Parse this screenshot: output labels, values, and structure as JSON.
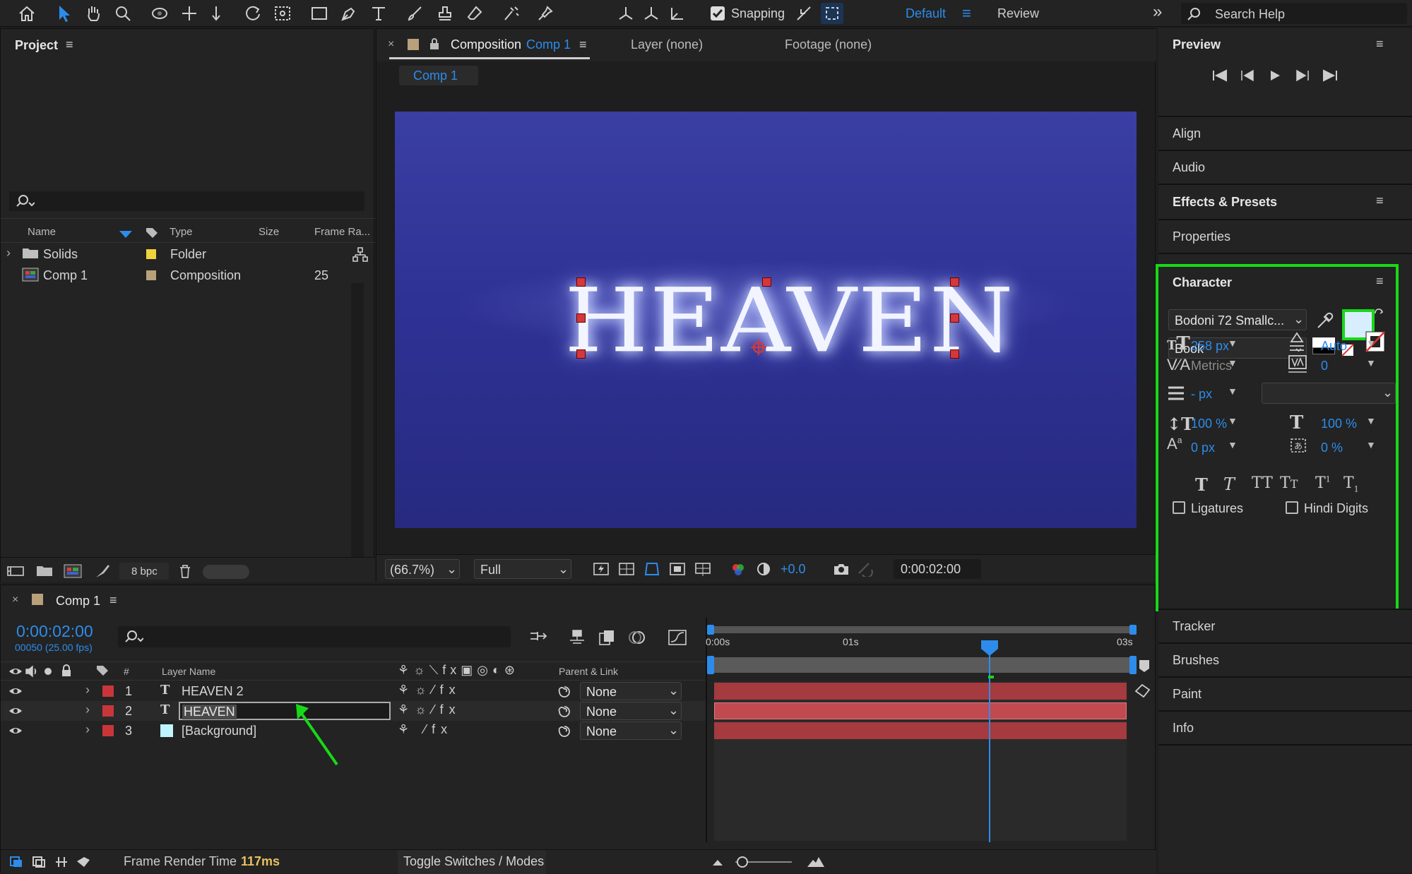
{
  "toolbar": {
    "snapping_label": "Snapping",
    "workspace_default": "Default",
    "workspace_review": "Review",
    "search_placeholder": "Search Help"
  },
  "project": {
    "title": "Project",
    "columns": {
      "name": "Name",
      "type": "Type",
      "size": "Size",
      "frame_rate": "Frame Ra..."
    },
    "items": [
      {
        "name": "Solids",
        "type": "Folder",
        "frame_rate": "",
        "color": "#f0d23c"
      },
      {
        "name": "Comp 1",
        "type": "Composition",
        "frame_rate": "25",
        "color": "#b8a07a"
      }
    ],
    "bit_depth": "8 bpc"
  },
  "composition": {
    "tab_prefix": "Composition",
    "tab_name": "Comp 1",
    "layer_tab": "Layer (none)",
    "footage_tab": "Footage (none)",
    "breadcrumb": "Comp 1",
    "canvas_text": "HEAVEN",
    "zoom": "(66.7%)",
    "resolution": "Full",
    "exposure": "+0.0",
    "timecode": "0:00:02:00"
  },
  "right_panels": {
    "preview": "Preview",
    "align": "Align",
    "audio": "Audio",
    "effects": "Effects & Presets",
    "properties": "Properties",
    "tracker": "Tracker",
    "brushes": "Brushes",
    "paint": "Paint",
    "info": "Info"
  },
  "character": {
    "title": "Character",
    "font_family": "Bodoni 72 Smallc...",
    "font_style": "Book",
    "font_size": "258 px",
    "leading": "Auto",
    "kerning": "Metrics",
    "tracking": "0",
    "stroke_width": "- px",
    "vertical_scale": "100 %",
    "horizontal_scale": "100 %",
    "baseline_shift": "0 px",
    "tsume": "0 %",
    "ligatures": "Ligatures",
    "hindi_digits": "Hindi Digits",
    "fill_color": "#d8eeff"
  },
  "timeline": {
    "comp_name": "Comp 1",
    "current_time": "0:00:02:00",
    "frame_info": "00050 (25.00 fps)",
    "columns": {
      "num": "#",
      "layer_name": "Layer Name",
      "parent": "Parent & Link"
    },
    "ruler": [
      "0:00s",
      "01s",
      "03s"
    ],
    "layers": [
      {
        "num": "1",
        "name": "HEAVEN 2",
        "type_icon": "T",
        "parent": "None",
        "color": "#c8363a"
      },
      {
        "num": "2",
        "name": "HEAVEN",
        "type_icon": "T",
        "parent": "None",
        "color": "#c8363a"
      },
      {
        "num": "3",
        "name": "[Background]",
        "type_icon": "",
        "parent": "None",
        "color": "#c8363a"
      }
    ],
    "render_time_label": "Frame Render Time",
    "render_time_value": "117ms",
    "toggle_label": "Toggle Switches / Modes"
  }
}
